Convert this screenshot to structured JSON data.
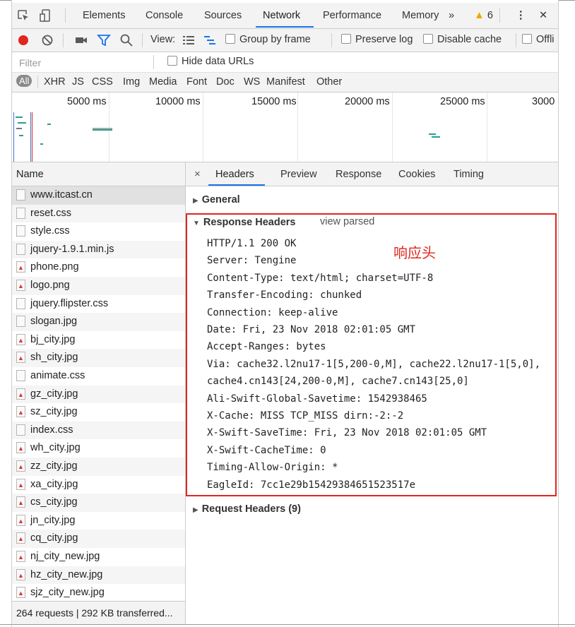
{
  "tabs": {
    "items": [
      "Elements",
      "Console",
      "Sources",
      "Network",
      "Performance",
      "Memory"
    ],
    "more": "»",
    "warnings": "6",
    "menu": "⋮",
    "close": "✕"
  },
  "toolbar": {
    "view_label": "View:",
    "group_by_frame": "Group by frame",
    "preserve_log": "Preserve log",
    "disable_cache": "Disable cache",
    "offline": "Offli"
  },
  "filter": {
    "placeholder": "Filter",
    "hide_data_urls": "Hide data URLs"
  },
  "types": [
    "All",
    "XHR",
    "JS",
    "CSS",
    "Img",
    "Media",
    "Font",
    "Doc",
    "WS",
    "Manifest",
    "Other"
  ],
  "overview": {
    "ticks": [
      "5000 ms",
      "10000 ms",
      "15000 ms",
      "20000 ms",
      "25000 ms",
      "3000"
    ]
  },
  "requests": {
    "header": "Name",
    "items": [
      {
        "name": "www.itcast.cn",
        "icon": "document-icon"
      },
      {
        "name": "reset.css",
        "icon": "document-icon"
      },
      {
        "name": "style.css",
        "icon": "document-icon"
      },
      {
        "name": "jquery-1.9.1.min.js",
        "icon": "document-icon"
      },
      {
        "name": "phone.png",
        "icon": "image-icon"
      },
      {
        "name": "logo.png",
        "icon": "image-icon"
      },
      {
        "name": "jquery.flipster.css",
        "icon": "document-icon"
      },
      {
        "name": "slogan.jpg",
        "icon": "document-icon"
      },
      {
        "name": "bj_city.jpg",
        "icon": "image-icon"
      },
      {
        "name": "sh_city.jpg",
        "icon": "image-icon"
      },
      {
        "name": "animate.css",
        "icon": "document-icon"
      },
      {
        "name": "gz_city.jpg",
        "icon": "image-icon"
      },
      {
        "name": "sz_city.jpg",
        "icon": "image-icon"
      },
      {
        "name": "index.css",
        "icon": "document-icon"
      },
      {
        "name": "wh_city.jpg",
        "icon": "image-icon"
      },
      {
        "name": "zz_city.jpg",
        "icon": "image-icon"
      },
      {
        "name": "xa_city.jpg",
        "icon": "image-icon"
      },
      {
        "name": "cs_city.jpg",
        "icon": "image-icon"
      },
      {
        "name": "jn_city.jpg",
        "icon": "image-icon"
      },
      {
        "name": "cq_city.jpg",
        "icon": "image-icon"
      },
      {
        "name": "nj_city_new.jpg",
        "icon": "image-icon"
      },
      {
        "name": "hz_city_new.jpg",
        "icon": "image-icon"
      },
      {
        "name": "sjz_city_new.jpg",
        "icon": "image-icon"
      }
    ],
    "status": "264 requests | 292 KB transferred..."
  },
  "detail": {
    "close": "×",
    "tabs": [
      "Headers",
      "Preview",
      "Response",
      "Cookies",
      "Timing"
    ],
    "general": "General",
    "response_headers": "Response Headers",
    "view_parsed": "view parsed",
    "annotation": "响应头",
    "lines": [
      "HTTP/1.1 200 OK",
      "Server: Tengine",
      "Content-Type: text/html; charset=UTF-8",
      "Transfer-Encoding: chunked",
      "Connection: keep-alive",
      "Date: Fri, 23 Nov 2018 02:01:05 GMT",
      "Accept-Ranges: bytes",
      "Via: cache32.l2nu17-1[5,200-0,M], cache22.l2nu17-1[5,0],",
      "cache4.cn143[24,200-0,M], cache7.cn143[25,0]",
      "Ali-Swift-Global-Savetime: 1542938465",
      "X-Cache: MISS TCP_MISS dirn:-2:-2",
      "X-Swift-SaveTime: Fri, 23 Nov 2018 02:01:05 GMT",
      "X-Swift-CacheTime: 0",
      "Timing-Allow-Origin: *",
      "EagleId: 7cc1e29b15429384651523517e"
    ],
    "request_headers": "Request Headers (9)"
  },
  "colors": {
    "accent": "#1a73e8",
    "record": "#e0261f",
    "highlight": "#e0261f",
    "warning": "#f2a600"
  }
}
